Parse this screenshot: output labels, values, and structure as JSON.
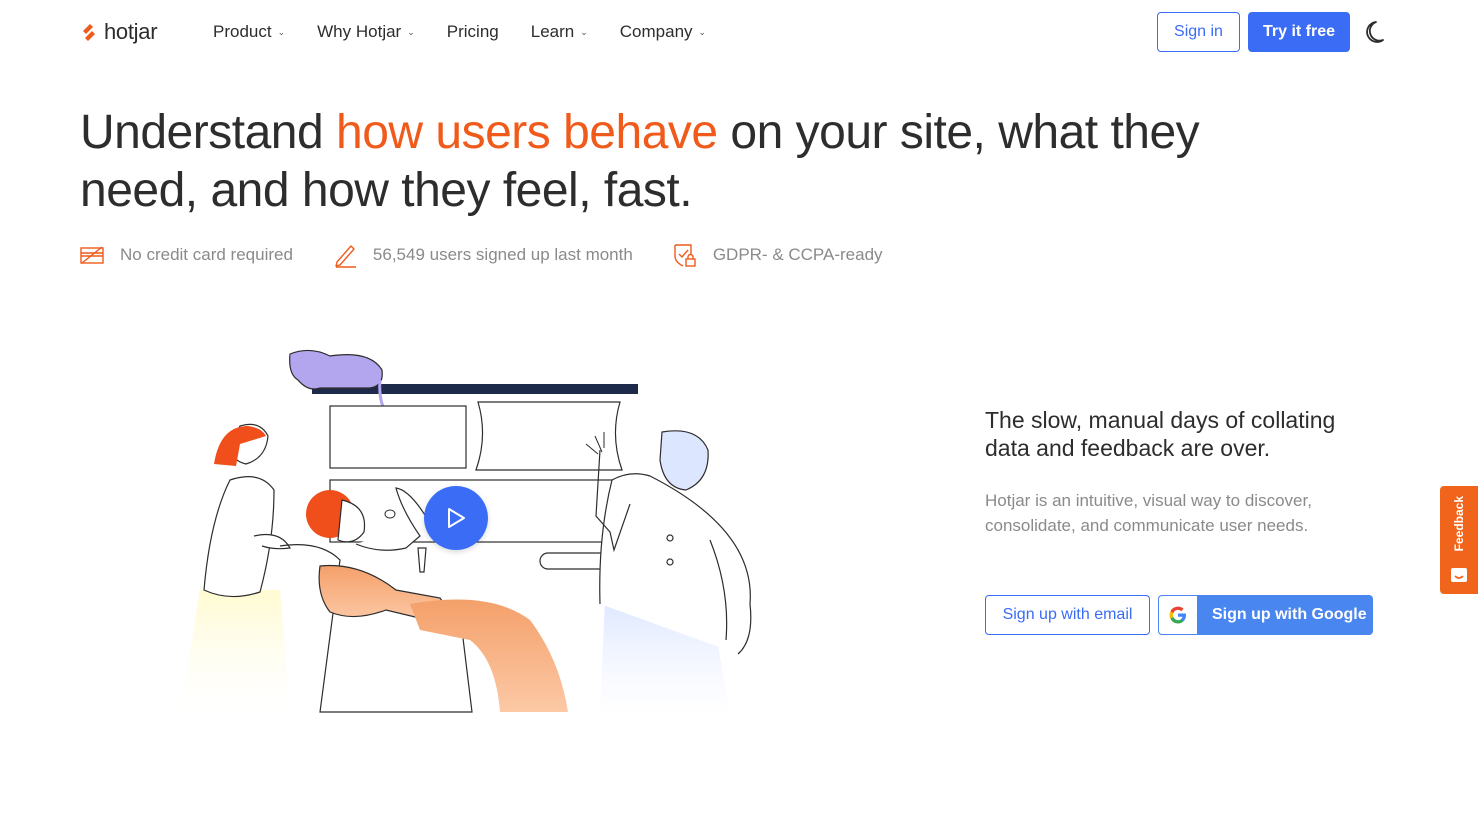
{
  "brand": {
    "name": "hotjar",
    "accent": "#f05a1a",
    "primary": "#3b6cf5"
  },
  "nav": {
    "items": [
      {
        "label": "Product",
        "has_dropdown": true
      },
      {
        "label": "Why Hotjar",
        "has_dropdown": true
      },
      {
        "label": "Pricing",
        "has_dropdown": false
      },
      {
        "label": "Learn",
        "has_dropdown": true
      },
      {
        "label": "Company",
        "has_dropdown": true
      }
    ],
    "sign_in": "Sign in",
    "try_free": "Try it free",
    "theme_icon": "moon-icon"
  },
  "hero": {
    "headline_pre": "Understand ",
    "headline_highlight": "how users behave",
    "headline_post": " on your site, what they need, and how they feel, fast.",
    "badges": [
      {
        "icon": "credit-card-icon",
        "text": "No credit card required"
      },
      {
        "icon": "pencil-icon",
        "text": "56,549 users signed up last month"
      },
      {
        "icon": "shield-lock-icon",
        "text": "GDPR- & CCPA-ready"
      }
    ]
  },
  "video": {
    "play_icon": "play-icon"
  },
  "side": {
    "heading": "The slow, manual days of collating data and feedback are over.",
    "body": "Hotjar is an intuitive, visual way to discover, consolidate, and communicate user needs.",
    "email_button": "Sign up with email",
    "google_button": "Sign up with Google"
  },
  "feedback_tab": {
    "label": "Feedback"
  }
}
